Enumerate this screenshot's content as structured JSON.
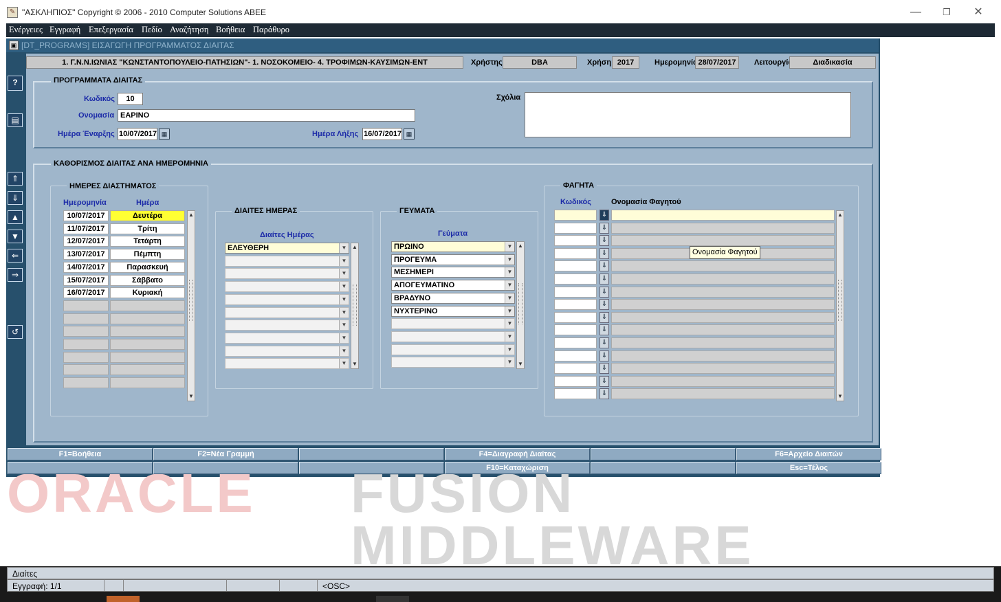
{
  "window": {
    "title": "\"ΑΣΚΛΗΠΙΟΣ\" Copyright © 2006 - 2010 Computer Solutions ABEE"
  },
  "menu": [
    "Ενέργειες",
    "Εγγραφή",
    "Επεξεργασία",
    "Πεδίο",
    "Αναζήτηση",
    "Βοήθεια",
    "Παράθυρο"
  ],
  "form_title": "[DT_PROGRAMS]   ΕΙΣΑΓΩΓΗ ΠΡΟΓΡΑΜΜΑΤΟΣ ΔΙΑΙΤΑΣ",
  "infobar": {
    "org": "1. Γ.Ν.Ν.ΙΩΝΙΑΣ \"ΚΩΝΣΤΑΝΤΟΠΟΥΛΕΙΟ-ΠΑΤΗΣΙΩΝ\"- 1. ΝΟΣΟΚΟΜΕΙΟ- 4. ΤΡΟΦΙΜΩΝ-ΚΑΥΣΙΜΩΝ-ΕΝΤ",
    "user_label": "Χρήστης",
    "user": "DBA",
    "year_label": "Χρήση",
    "year": "2017",
    "date_label": "Ημερομηνία",
    "date": "28/07/2017",
    "func_label": "Λειτουργία",
    "func": "Διαδικασία"
  },
  "program": {
    "title": "ΠΡΟΓΡΑΜΜΑΤΑ ΔΙΑΙΤΑΣ",
    "code_label": "Κωδικός",
    "code": "10",
    "name_label": "Ονομασία",
    "name": "ΕΑΡΙΝΟ",
    "start_label": "Ημέρα Έναρξης",
    "start": "10/07/2017",
    "end_label": "Ημέρα Λήξης",
    "end": "16/07/2017",
    "comments_label": "Σχόλια",
    "comments": ""
  },
  "schedule": {
    "title": "ΚΑΘΟΡΙΣΜΟΣ ΔΙΑΙΤΑΣ ΑΝΑ ΗΜΕΡΟΜΗΝΙΑ",
    "days": {
      "title": "ΗΜΕΡΕΣ ΔΙΑΣΤΗΜΑΤΟΣ",
      "col_date": "Ημερομηνία",
      "col_day": "Ημέρα",
      "rows": [
        {
          "date": "10/07/2017",
          "day": "Δευτέρα"
        },
        {
          "date": "11/07/2017",
          "day": "Τρίτη"
        },
        {
          "date": "12/07/2017",
          "day": "Τετάρτη"
        },
        {
          "date": "13/07/2017",
          "day": "Πέμπτη"
        },
        {
          "date": "14/07/2017",
          "day": "Παρασκευή"
        },
        {
          "date": "15/07/2017",
          "day": "Σάββατο"
        },
        {
          "date": "16/07/2017",
          "day": "Κυριακή"
        },
        {
          "date": "",
          "day": ""
        },
        {
          "date": "",
          "day": ""
        },
        {
          "date": "",
          "day": ""
        },
        {
          "date": "",
          "day": ""
        },
        {
          "date": "",
          "day": ""
        },
        {
          "date": "",
          "day": ""
        },
        {
          "date": "",
          "day": ""
        }
      ]
    },
    "diets": {
      "title": "ΔΙΑΙΤΕΣ ΗΜΕΡΑΣ",
      "col": "Διαίτες Ημέρας",
      "rows": [
        "ΕΛΕΥΘΕΡΗ",
        "",
        "",
        "",
        "",
        "",
        "",
        "",
        "",
        ""
      ]
    },
    "meals": {
      "title": "ΓΕΥΜΑΤΑ",
      "col": "Γεύματα",
      "rows": [
        "ΠΡΩΙΝΟ",
        "ΠΡΟΓΕΥΜΑ",
        "ΜΕΣΗΜΕΡΙ",
        "ΑΠΟΓΕΥΜΑΤΙΝΟ",
        "ΒΡΑΔΥΝΟ",
        "ΝΥΧΤΕΡΙΝΟ",
        "",
        "",
        "",
        ""
      ]
    },
    "foods": {
      "title": "ΦΑΓΗΤΑ",
      "col_code": "Κωδικός",
      "col_name": "Ονομασία Φαγητού",
      "rows": 15,
      "tooltip": "Ονομασία Φαγητού"
    }
  },
  "fkeys_row1": [
    "F1=Βοήθεια",
    "F2=Νέα Γραμμή",
    "",
    "F4=Διαγραφή Διαίτας",
    "",
    "F6=Αρχείο Διαιτών"
  ],
  "fkeys_row2": [
    "",
    "",
    "",
    "F10=Καταχώριση",
    "",
    "Esc=Τέλος"
  ],
  "watermark": {
    "a": "ORACLE",
    "b": "FUSION",
    "c": "MIDDLEWARE"
  },
  "status": {
    "line1": "Διαίτες",
    "record": "Εγγραφή: 1/1",
    "osc": "<OSC>"
  }
}
